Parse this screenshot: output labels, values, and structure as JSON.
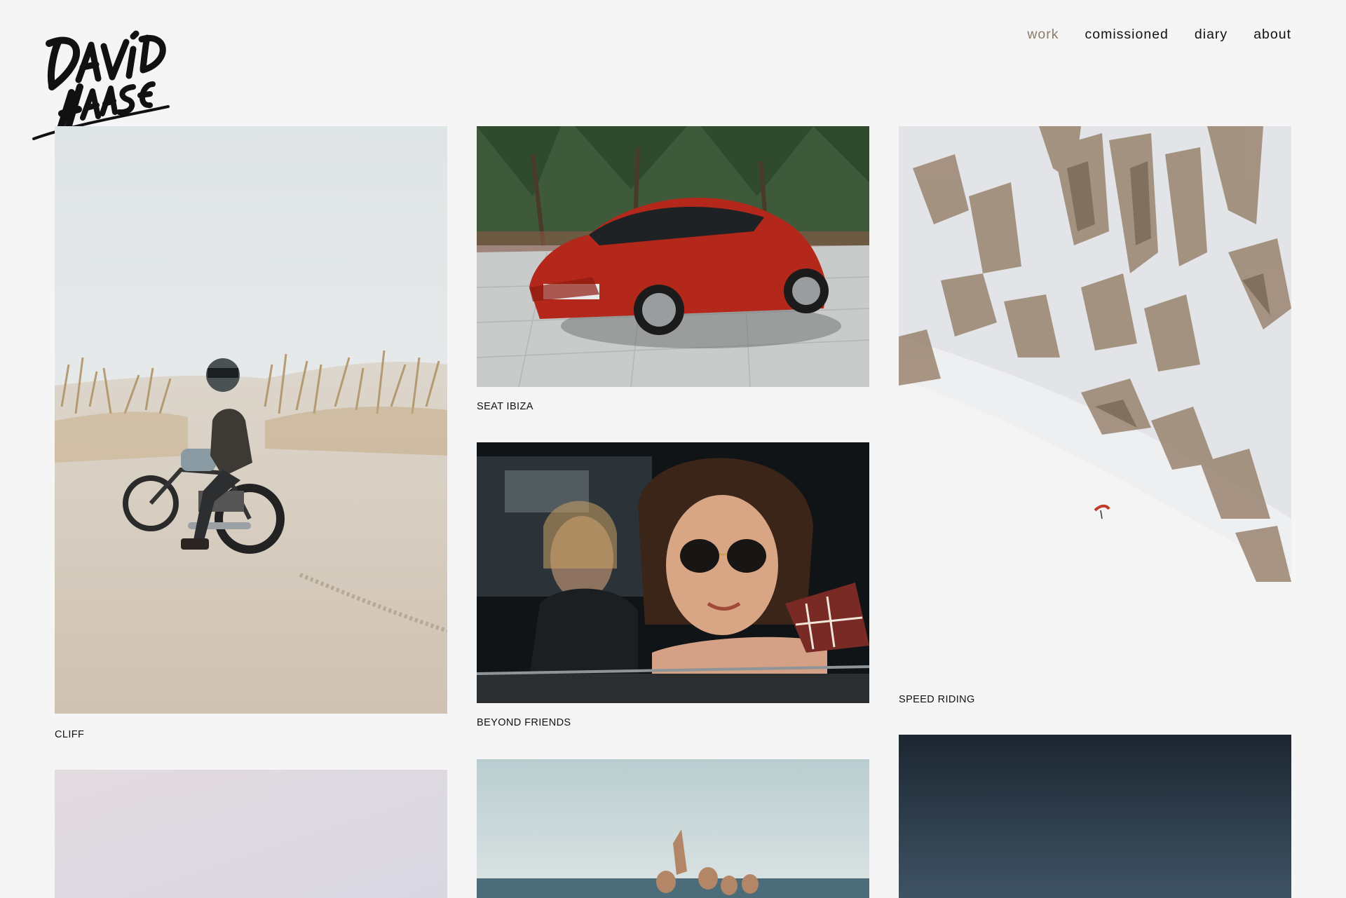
{
  "brand": {
    "logo_text": "DAVID HAASE"
  },
  "nav": {
    "items": [
      {
        "label": "work",
        "active": true
      },
      {
        "label": "comissioned",
        "active": false
      },
      {
        "label": "diary",
        "active": false
      },
      {
        "label": "about",
        "active": false
      }
    ]
  },
  "colors": {
    "background": "#f5f5f5",
    "text": "#111111",
    "nav_active": "#8c7b6a"
  },
  "gallery": {
    "projects": [
      {
        "title": "CLIFF",
        "image": "motorcyclist-on-beach-dunes"
      },
      {
        "title": "SEAT IBIZA",
        "image": "red-seat-ibiza-hatchback"
      },
      {
        "title": "SPEED RIDING",
        "image": "snowy-mountain-slope-with-rocks"
      },
      {
        "title": "BEYOND FRIENDS",
        "image": "woman-with-sunglasses-in-car-window"
      },
      {
        "title": "",
        "image": "pale-pastel-sky"
      },
      {
        "title": "",
        "image": "people-playing-in-sea"
      },
      {
        "title": "",
        "image": "dark-blue-evening-sky"
      }
    ]
  }
}
